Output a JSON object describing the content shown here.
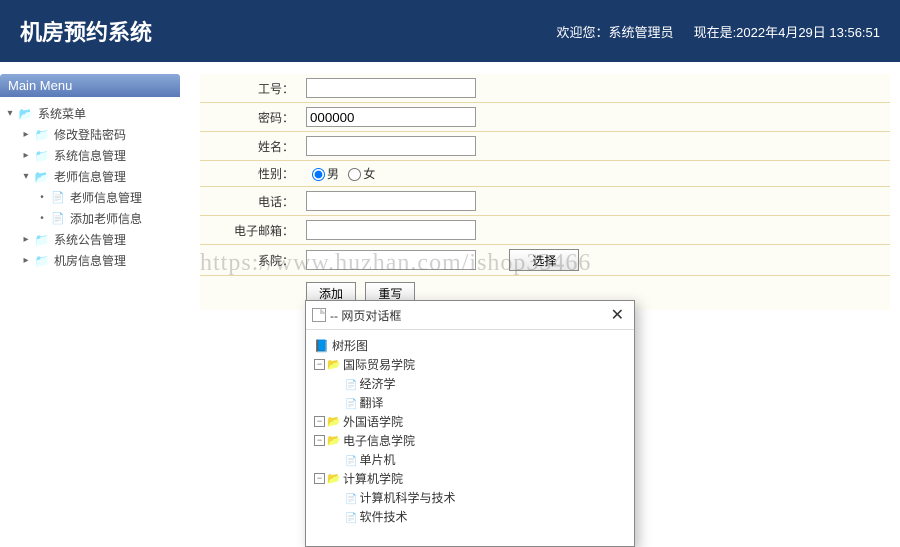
{
  "header": {
    "title": "机房预约系统",
    "welcome": "欢迎您：系统管理员",
    "datetime": "现在是:2022年4月29日 13:56:51"
  },
  "sidebar": {
    "menu_title": "Main Menu",
    "root": "系统菜单",
    "items": [
      {
        "label": "修改登陆密码"
      },
      {
        "label": "系统信息管理"
      },
      {
        "label": "老师信息管理",
        "children": [
          {
            "label": "老师信息管理"
          },
          {
            "label": "添加老师信息"
          }
        ]
      },
      {
        "label": "系统公告管理"
      },
      {
        "label": "机房信息管理"
      }
    ]
  },
  "form": {
    "fields": {
      "worker_id": {
        "label": "工号：",
        "value": ""
      },
      "password": {
        "label": "密码：",
        "value": "000000"
      },
      "name": {
        "label": "姓名：",
        "value": ""
      },
      "gender": {
        "label": "性别：",
        "male": "男",
        "female": "女",
        "selected": "male"
      },
      "phone": {
        "label": "电话：",
        "value": ""
      },
      "email": {
        "label": "电子邮箱：",
        "value": ""
      },
      "college": {
        "label": "系院：",
        "value": "",
        "choose": "选择"
      }
    },
    "buttons": {
      "submit": "添加",
      "reset": "重写"
    }
  },
  "dialog": {
    "title": "-- 网页对话框",
    "root": "树形图",
    "nodes": [
      {
        "label": "国际贸易学院",
        "children": [
          "经济学",
          "翻译"
        ]
      },
      {
        "label": "外国语学院",
        "children": []
      },
      {
        "label": "电子信息学院",
        "children": [
          "单片机"
        ]
      },
      {
        "label": "计算机学院",
        "children": [
          "计算机科学与技术",
          "软件技术"
        ]
      }
    ]
  },
  "watermark": "https://www.huzhan.com/ishop33466"
}
